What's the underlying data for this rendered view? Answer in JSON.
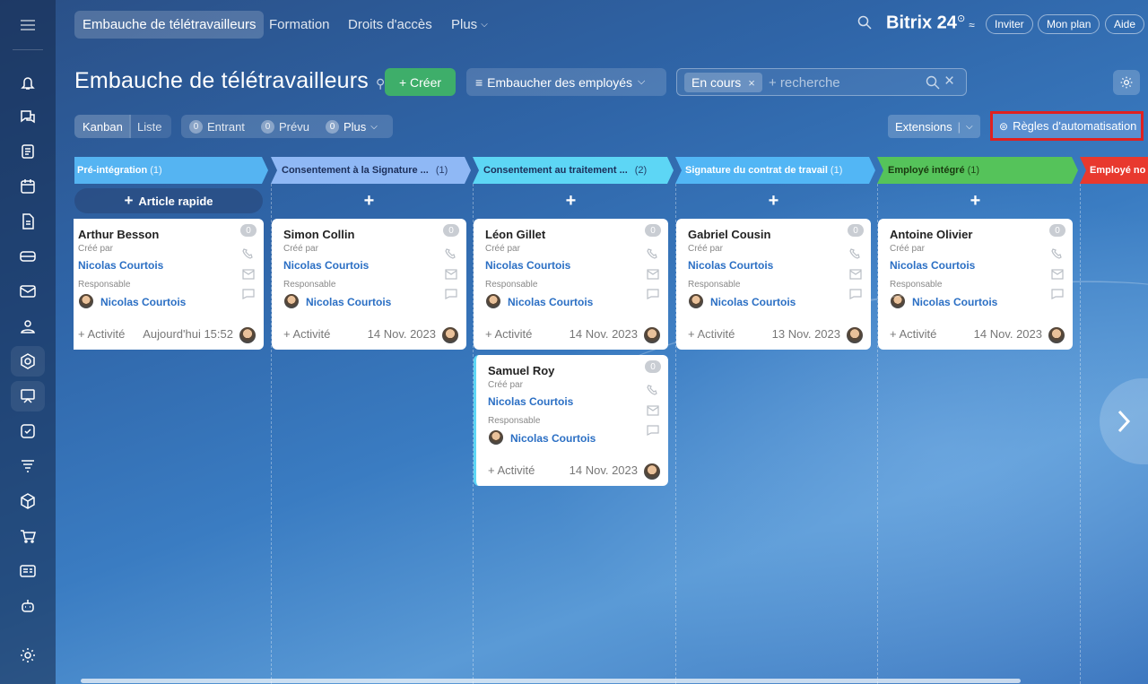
{
  "topbar": {
    "tabs": [
      "Embauche de télétravailleurs",
      "Formation",
      "Droits d'accès",
      "Plus"
    ],
    "brand": "Bitrix 24",
    "brand_sup": "⊙",
    "buttons": [
      "Inviter",
      "Mon plan",
      "Aide"
    ]
  },
  "header": {
    "title": "Embauche de télétravailleurs",
    "create_label": "+ Créer",
    "funnel_label": "Embaucher des employés",
    "filter_chip": "En cours",
    "search_placeholder": "+ recherche"
  },
  "toolbar": {
    "view_kanban": "Kanban",
    "view_list": "Liste",
    "counters": [
      {
        "count": "0",
        "label": "Entrant"
      },
      {
        "count": "0",
        "label": "Prévu"
      },
      {
        "count": "0",
        "label": "Plus"
      }
    ],
    "extensions_label": "Extensions",
    "automation_label": "Règles d'automatisation"
  },
  "stages": [
    {
      "name": "Pré-intégration",
      "count": "(1)",
      "color": "#55b4f2"
    },
    {
      "name": "Consentement à la Signature ...",
      "count": "(1)",
      "color": "#8fb8f5"
    },
    {
      "name": "Consentement au traitement ...",
      "count": "(2)",
      "color": "#5dd6f5"
    },
    {
      "name": "Signature du contrat de travail",
      "count": "(1)",
      "color": "#52b6f5"
    },
    {
      "name": "Employé intégré",
      "count": "(1)",
      "color": "#55c35a"
    },
    {
      "name": "Employé no",
      "count": "",
      "color": "#e8392e"
    }
  ],
  "quick_add": "Article rapide",
  "card_labels": {
    "created_by": "Créé par",
    "responsible": "Responsable",
    "activity": "+ Activité"
  },
  "cards": [
    {
      "name": "Arthur Besson",
      "creator": "Nicolas Courtois",
      "responsible": "Nicolas Courtois",
      "date": "Aujourd'hui 15:52",
      "badge": "0"
    },
    {
      "name": "Simon Collin",
      "creator": "Nicolas Courtois",
      "responsible": "Nicolas Courtois",
      "date": "14 Nov. 2023",
      "badge": "0"
    },
    {
      "name": "Léon Gillet",
      "creator": "Nicolas Courtois",
      "responsible": "Nicolas Courtois",
      "date": "14 Nov. 2023",
      "badge": "0"
    },
    {
      "name": "Samuel Roy",
      "creator": "Nicolas Courtois",
      "responsible": "Nicolas Courtois",
      "date": "14 Nov. 2023",
      "badge": "0"
    },
    {
      "name": "Gabriel Cousin",
      "creator": "Nicolas Courtois",
      "responsible": "Nicolas Courtois",
      "date": "13 Nov. 2023",
      "badge": "0"
    },
    {
      "name": "Antoine Olivier",
      "creator": "Nicolas Courtois",
      "responsible": "Nicolas Courtois",
      "date": "14 Nov. 2023",
      "badge": "0"
    }
  ],
  "sidebar_icons": [
    "menu-icon",
    "bell-icon",
    "chat-icon",
    "feed-icon",
    "calendar-icon",
    "document-icon",
    "drive-icon",
    "mail-icon",
    "contacts-icon",
    "crm-icon",
    "sites-icon",
    "tasks-icon",
    "funnel-icon",
    "box-icon",
    "cart-icon",
    "id-card-icon",
    "robot-icon",
    "settings-icon"
  ]
}
